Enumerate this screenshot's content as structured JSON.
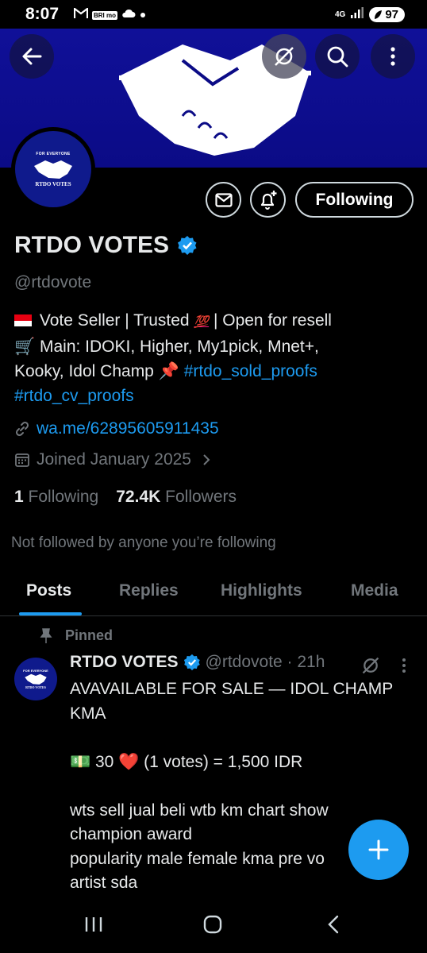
{
  "status_bar": {
    "time": "8:07",
    "left_icons": [
      "gmail-icon",
      "bri-mo-icon",
      "cloud-icon",
      "dot-icon"
    ],
    "bri_label": "BRI mo",
    "network": "4G",
    "battery": "97"
  },
  "header": {
    "back_icon": "arrow-left-icon",
    "grok_icon": "grok-icon",
    "search_icon": "search-icon",
    "more_icon": "vertical-dots-icon",
    "banner_color": "#0b0b86"
  },
  "profile": {
    "avatar_top_text": "FOR EVERYONE",
    "avatar_bottom_text": "RTDO VOTES",
    "name": "RTDO VOTES",
    "handle": "@rtdovote",
    "verified": true,
    "follow_button": "Following",
    "bio_line1": "Vote Seller | Trusted",
    "bio_100": "💯",
    "bio_line1_end": "| Open for resell",
    "bio_line2": "🛒 Main: IDOKI, Higher, My1pick, Mnet+,",
    "bio_line3": "Kooky, Idol Champ 📌",
    "bio_tag1": "#rtdo_sold_proofs",
    "bio_tag2": "#rtdo_cv_proofs",
    "link": "wa.me/62895605911435",
    "joined": "Joined January 2025",
    "following_count": "1",
    "following_label": "Following",
    "followers_count": "72.4K",
    "followers_label": "Followers",
    "not_followed": "Not followed by anyone you’re following"
  },
  "tabs": [
    "Posts",
    "Replies",
    "Highlights",
    "Media"
  ],
  "post": {
    "pinned_label": "Pinned",
    "author_name": "RTDO VOTES",
    "author_handle": "@rtdovote · 21h",
    "lines": [
      "AVAVAILABLE FOR SALE — IDOL CHAMP",
      "KMA",
      "",
      "💵 30 ❤️ (1 votes) = 1,500 IDR",
      "",
      "wts sell jual beli wtb km chart show",
      "champion award",
      "popularity male female kma pre vo",
      "artist sda"
    ]
  },
  "fab_icon": "plus-icon",
  "nav": [
    "recents-icon",
    "home-icon",
    "back-icon"
  ],
  "colors": {
    "accent": "#1d9bf0",
    "muted": "#71767b",
    "text": "#e7e9ea"
  }
}
